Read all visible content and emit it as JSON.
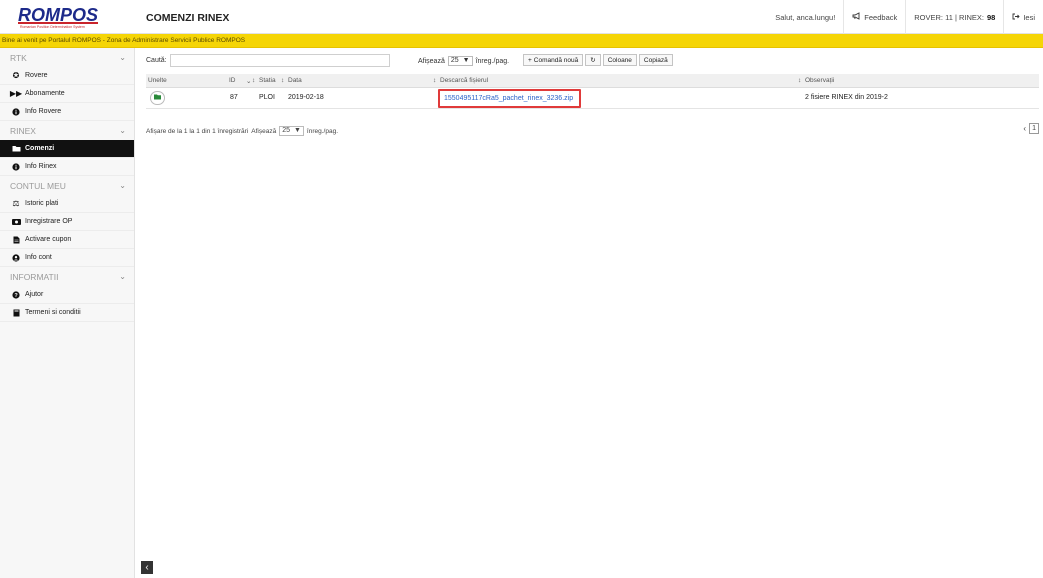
{
  "logo": {
    "text": "ROMPOS",
    "subtitle": "Romanian Position Determination System"
  },
  "header": {
    "page_title": "COMENZI RINEX",
    "greeting": "Salut, anca.lungu!",
    "feedback_label": "Feedback",
    "counters_label": "ROVER: 11 | RINEX: ",
    "counters_bold": "98",
    "logout_label": "Iesi"
  },
  "banner": {
    "text": "Bine ai venit pe Portalul ROMPOS - Zona de Administrare Servicii Publice ROMPOS"
  },
  "sidebar": {
    "sections": [
      {
        "title": "RTK",
        "items": [
          {
            "label": "Rovere",
            "icon": "pin-icon"
          },
          {
            "label": "Abonamente",
            "icon": "fast-forward-icon"
          },
          {
            "label": "Info Rovere",
            "icon": "info-icon"
          }
        ]
      },
      {
        "title": "RINEX",
        "items": [
          {
            "label": "Comenzi",
            "icon": "folder-icon",
            "active": true
          },
          {
            "label": "Info Rinex",
            "icon": "info-icon"
          }
        ]
      },
      {
        "title": "CONTUL MEU",
        "items": [
          {
            "label": "Istoric plati",
            "icon": "balance-icon"
          },
          {
            "label": "Inregistrare OP",
            "icon": "money-icon"
          },
          {
            "label": "Activare cupon",
            "icon": "document-icon"
          },
          {
            "label": "Info cont",
            "icon": "user-circle-icon"
          }
        ]
      },
      {
        "title": "INFORMATII",
        "items": [
          {
            "label": "Ajutor",
            "icon": "question-icon"
          },
          {
            "label": "Termeni si conditii",
            "icon": "book-icon"
          }
        ]
      }
    ]
  },
  "toolbar": {
    "search_label": "Caută:",
    "search_value": "",
    "show_label": "Afișează",
    "page_size": "25",
    "per_page_label": "înreg./pag.",
    "new_order_label": "Comandă nouă",
    "columns_label": "Coloane",
    "copy_label": "Copiază"
  },
  "table": {
    "columns": [
      "Unelte",
      "ID",
      "Statia",
      "Data",
      "Descarcă fișierul",
      "Observații"
    ],
    "rows": [
      {
        "id": "87",
        "station": "PLOI",
        "date": "2019-02-18",
        "file": "1550495117cRa5_pachet_rinex_3236.zip",
        "notes": "2 fisiere RINEX din 2019-2"
      }
    ]
  },
  "footer": {
    "info": "Afișare de la 1 la 1 din 1 înregistrări",
    "show_label": "Afișează",
    "page_size": "25",
    "per_page_label": "înreg./pag.",
    "current_page": "1"
  },
  "colors": {
    "banner": "#f5d506",
    "active_nav": "#111111",
    "link": "#2a62c9",
    "highlight_box": "#e03a3a"
  }
}
